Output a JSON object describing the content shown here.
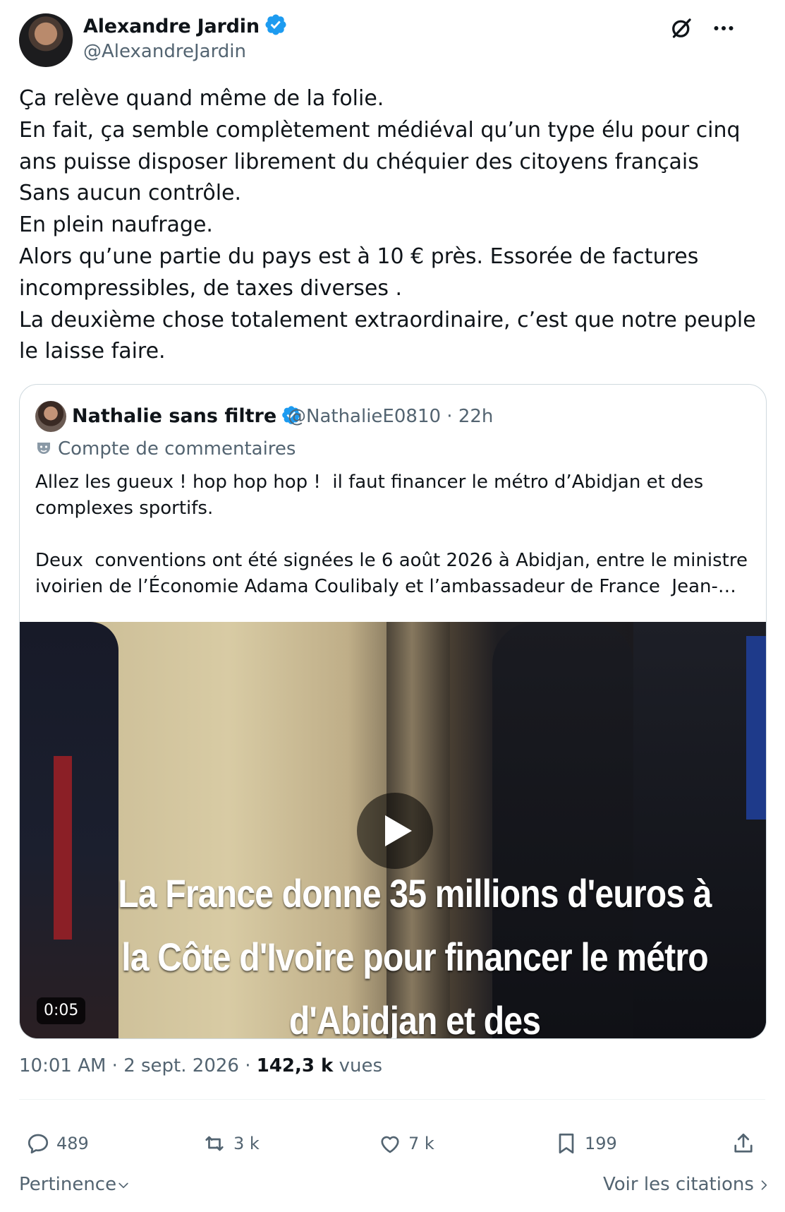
{
  "author": {
    "name": "Alexandre Jardin",
    "handle": "@AlexandreJardin"
  },
  "tweet_text": "Ça relève quand même de la folie.\nEn fait, ça semble complètement médiéval qu’un type élu pour cinq ans puisse disposer librement du chéquier des citoyens français\nSans aucun contrôle.\nEn plein naufrage.\nAlors qu’une partie du pays est à 10 € près. Essorée de factures incompressibles, de taxes diverses .\nLa deuxième chose totalement extraordinaire, c’est que notre peuple le laisse faire.",
  "quote": {
    "name": "Nathalie sans filtre",
    "handle": "@NathalieE0810",
    "time": "· 22h",
    "account_type": "Compte de commentaires",
    "text": "Allez les gueux ! hop hop hop !  il faut financer le métro d’Abidjan et des complexes sportifs.\n\nDeux  conventions ont été signées le 6 août 2026 à Abidjan, entre le ministre ivoirien de l’Économie Adama Coulibaly et l’ambassadeur de France  Jean-…",
    "video_caption": "La France donne 35 millions d'euros à la Côte d'Ivoire pour financer le métro d'Abidjan et des",
    "video_duration": "0:05"
  },
  "meta": {
    "time": "10:01 AM · 2 sept. 2026 · ",
    "views_count": "142,3 k",
    "views_label": " vues"
  },
  "actions": {
    "replies": "489",
    "reposts": "3 k",
    "likes": "7 k",
    "bookmarks": "199"
  },
  "footer": {
    "sort_label": "Pertinence",
    "quotes_link": "Voir les citations"
  },
  "colors": {
    "verified": "#1d9bf0",
    "secondary": "#536471",
    "primary_text": "#0f1419"
  },
  "icons": [
    "grok-icon",
    "more-icon",
    "verified-icon",
    "reply-icon",
    "repost-icon",
    "like-icon",
    "bookmark-icon",
    "share-icon",
    "play-icon",
    "chevron-down-icon",
    "chevron-right-icon"
  ]
}
